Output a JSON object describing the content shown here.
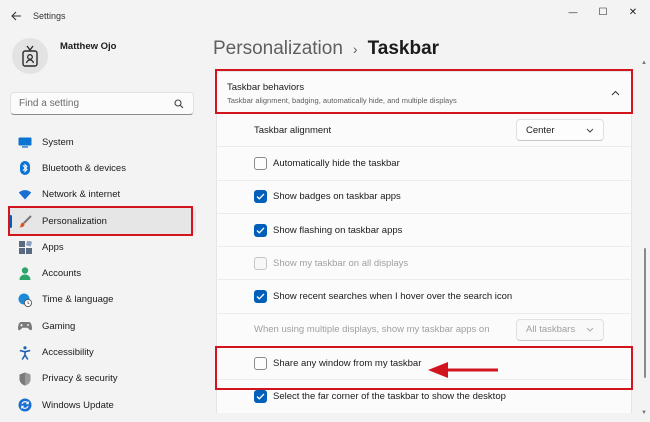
{
  "window": {
    "title": "Settings",
    "controls": {
      "minimize": "—",
      "maximize": "☐",
      "close": "✕"
    }
  },
  "user": {
    "name": "Matthew Ojo"
  },
  "search": {
    "placeholder": "Find a setting"
  },
  "sidebar": {
    "items": [
      {
        "label": "System",
        "icon": "system-monitor-icon",
        "color": "#0a74d0"
      },
      {
        "label": "Bluetooth & devices",
        "icon": "bluetooth-icon",
        "color": "#0a74d0"
      },
      {
        "label": "Network & internet",
        "icon": "wifi-icon",
        "color": "#1a6fd1"
      },
      {
        "label": "Personalization",
        "icon": "paintbrush-icon",
        "color": "#d8581c",
        "active": true
      },
      {
        "label": "Apps",
        "icon": "apps-icon",
        "color": "#5a6a80"
      },
      {
        "label": "Accounts",
        "icon": "person-icon",
        "color": "#2aa66a"
      },
      {
        "label": "Time & language",
        "icon": "globe-clock-icon",
        "color": "#1b8ad9"
      },
      {
        "label": "Gaming",
        "icon": "controller-icon",
        "color": "#7a7a7a"
      },
      {
        "label": "Accessibility",
        "icon": "accessibility-icon",
        "color": "#1b5fb0"
      },
      {
        "label": "Privacy & security",
        "icon": "shield-icon",
        "color": "#7a7a7a"
      },
      {
        "label": "Windows Update",
        "icon": "update-icon",
        "color": "#1b6fd1"
      }
    ]
  },
  "breadcrumb": {
    "parent": "Personalization",
    "separator": "›",
    "current": "Taskbar"
  },
  "section": {
    "title": "Taskbar behaviors",
    "subtitle": "Taskbar alignment, badging, automatically hide, and multiple displays",
    "rows": {
      "alignment": {
        "label": "Taskbar alignment",
        "value": "Center"
      },
      "auto_hide": {
        "label": "Automatically hide the taskbar",
        "checked": false
      },
      "badges": {
        "label": "Show badges on taskbar apps",
        "checked": true
      },
      "flashing": {
        "label": "Show flashing on taskbar apps",
        "checked": true
      },
      "all_displays": {
        "label": "Show my taskbar on all displays",
        "checked": false,
        "disabled": true
      },
      "recent_searches": {
        "label": "Show recent searches when I hover over the search icon",
        "checked": true
      },
      "multi_display": {
        "label": "When using multiple displays, show my taskbar apps on",
        "value": "All taskbars",
        "disabled": true
      },
      "share_window": {
        "label": "Share any window from my taskbar",
        "checked": false
      },
      "far_corner": {
        "label": "Select the far corner of the taskbar to show the desktop",
        "checked": true
      }
    }
  },
  "colors": {
    "accent": "#005fb8",
    "highlight": "#d1141e"
  }
}
